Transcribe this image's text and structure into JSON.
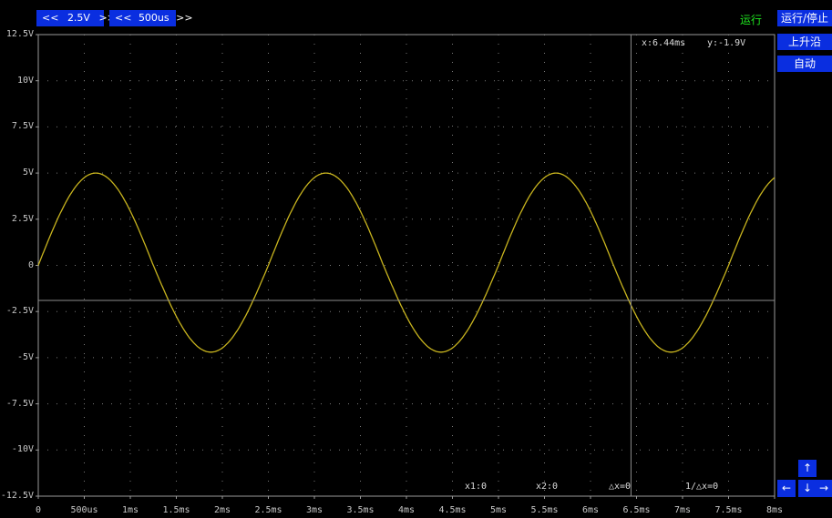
{
  "toolbar": {
    "volt_div": {
      "left": "<<",
      "value": "2.5V",
      "right": ">>"
    },
    "time_div": {
      "left": "<<",
      "value": "500us",
      "right": ">>"
    }
  },
  "status": "运行",
  "side": {
    "run_stop": "运行/停止",
    "trigger_edge": "上升沿",
    "mode": "自动"
  },
  "cursor_readout": {
    "x": "x:6.44ms",
    "y": "y:-1.9V"
  },
  "bottom_readout": {
    "x1": "x1:0",
    "x2": "x2:0",
    "dx": "△x=0",
    "inv_dx": "1/△x=0"
  },
  "nav": {
    "up": "↑",
    "left": "←",
    "down": "↓",
    "right": "→"
  },
  "axes": {
    "y_labels": [
      "12.5V",
      "10V",
      "7.5V",
      "5V",
      "2.5V",
      "0",
      "-2.5V",
      "-5V",
      "-7.5V",
      "-10V",
      "-12.5V"
    ],
    "x_labels": [
      "0",
      "500us",
      "1ms",
      "1.5ms",
      "2ms",
      "2.5ms",
      "3ms",
      "3.5ms",
      "4ms",
      "4.5ms",
      "5ms",
      "5.5ms",
      "6ms",
      "6.5ms",
      "7ms",
      "7.5ms",
      "8ms"
    ]
  },
  "chart_data": {
    "type": "line",
    "series": [
      {
        "signal": "sine",
        "amplitude_pos": 5,
        "amplitude_neg": -4.7,
        "period_ms": 2.5,
        "phase_start_ms": 0,
        "offset": 0,
        "color": "#c8b41e"
      }
    ],
    "xlim": [
      0,
      8
    ],
    "ylim": [
      -12.5,
      12.5
    ],
    "x_unit": "ms",
    "y_unit": "V",
    "cursor": {
      "x": 6.44,
      "y": -1.9
    },
    "grid": true
  },
  "colors": {
    "accent": "#0a2ee0",
    "status": "#1fe61f",
    "trace": "#c8b41e",
    "grid": "#7a7a7a"
  }
}
